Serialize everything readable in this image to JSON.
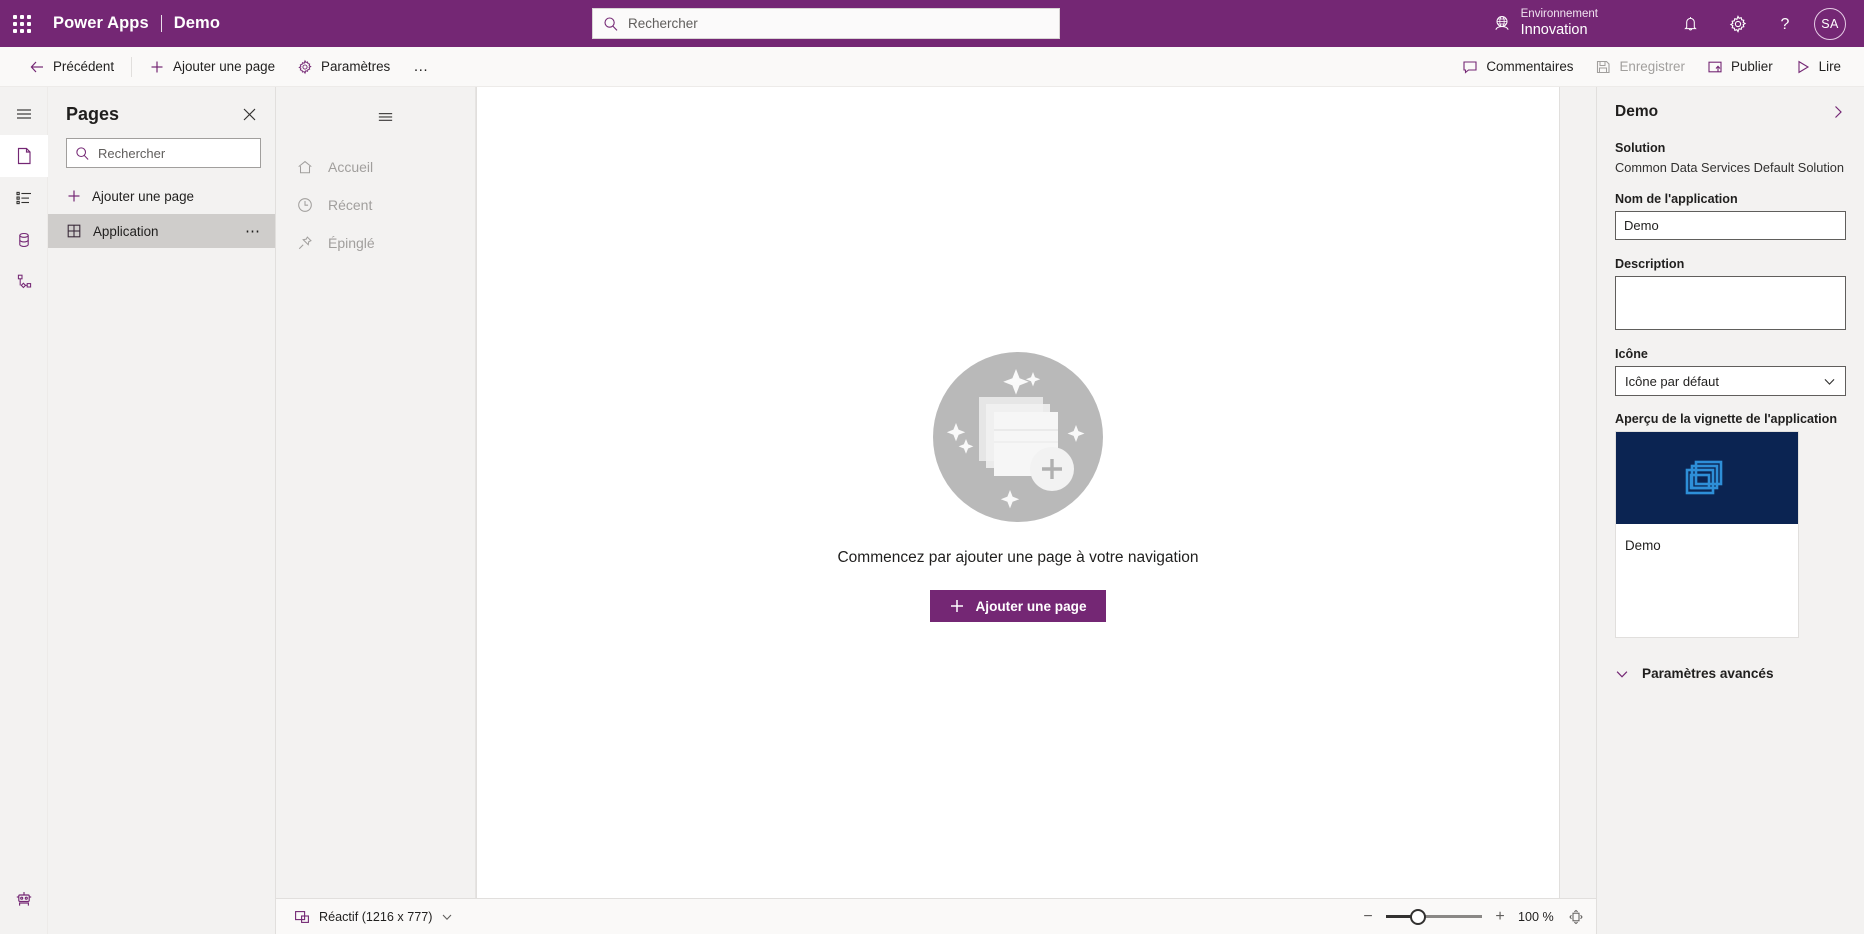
{
  "brand": {
    "waffle_icon": "app-launcher-icon",
    "product": "Power Apps",
    "separator": "|",
    "app_name": "Demo"
  },
  "search": {
    "placeholder": "Rechercher",
    "value": "",
    "icon": "search-icon"
  },
  "environment": {
    "icon": "globe-icon",
    "label": "Environnement",
    "name": "Innovation"
  },
  "header_actions": {
    "notifications_icon": "bell-icon",
    "settings_icon": "gear-icon",
    "help_icon": "question-mark-icon",
    "avatar_initials": "SA"
  },
  "commandbar": {
    "back": {
      "label": "Précédent",
      "icon": "arrow-left-icon"
    },
    "add_page": {
      "label": "Ajouter une page",
      "icon": "plus-icon"
    },
    "settings": {
      "label": "Paramètres",
      "icon": "gear-icon"
    },
    "overflow": {
      "label": "…",
      "icon": "ellipsis-icon"
    },
    "comments": {
      "label": "Commentaires",
      "icon": "comment-icon"
    },
    "save": {
      "label": "Enregistrer",
      "icon": "save-icon",
      "disabled": true
    },
    "publish": {
      "label": "Publier",
      "icon": "publish-icon"
    },
    "play": {
      "label": "Lire",
      "icon": "play-icon"
    }
  },
  "rail": {
    "items": [
      {
        "icon": "hamburger-menu-icon",
        "name": "menu",
        "selected": false
      },
      {
        "icon": "page-icon",
        "name": "pages",
        "selected": true
      },
      {
        "icon": "navigation-list-icon",
        "name": "navigation",
        "selected": false
      },
      {
        "icon": "data-cylinder-icon",
        "name": "data",
        "selected": false
      },
      {
        "icon": "automation-flow-icon",
        "name": "automation",
        "selected": false
      }
    ],
    "bottom": {
      "icon": "copilot-robot-icon",
      "name": "copilot"
    }
  },
  "pages_panel": {
    "title": "Pages",
    "close_icon": "close-icon",
    "search_placeholder": "Rechercher",
    "search_value": "",
    "search_icon": "search-icon",
    "add_page_label": "Ajouter une page",
    "add_page_icon": "plus-icon",
    "tree": [
      {
        "label": "Application",
        "icon": "app-grid-icon",
        "more_icon": "ellipsis-icon",
        "selected": true
      }
    ]
  },
  "app_preview_nav": {
    "burger_icon": "hamburger-menu-icon",
    "items": [
      {
        "label": "Accueil",
        "icon": "home-icon"
      },
      {
        "label": "Récent",
        "icon": "clock-icon"
      },
      {
        "label": "Épinglé",
        "icon": "pin-icon"
      }
    ]
  },
  "empty_state": {
    "illustration": "stacked-pages-add-illustration",
    "message": "Commencez par ajouter une page à votre navigation",
    "button_label": "Ajouter une page",
    "button_icon": "plus-icon"
  },
  "statusbar": {
    "screen_size_icon": "responsive-screen-icon",
    "screen_size_label": "Réactif (1216 x 777)",
    "chevron_icon": "chevron-down-icon",
    "zoom_out_icon": "minus-icon",
    "zoom_in_icon": "plus-icon",
    "zoom_value": "100 %",
    "fit_icon": "fit-to-screen-icon",
    "slider_percent": 25
  },
  "properties": {
    "title": "Demo",
    "collapse_icon": "chevron-right-icon",
    "solution_label": "Solution",
    "solution_value": "Common Data Services Default Solution",
    "app_name_label": "Nom de l'application",
    "app_name_value": "Demo",
    "description_label": "Description",
    "description_value": "",
    "icon_label": "Icône",
    "icon_value": "Icône par défaut",
    "icon_chevron": "chevron-down-icon",
    "tile_preview_label": "Aperçu de la vignette de l'application",
    "tile_icon": "app-window-stack-icon",
    "tile_name": "Demo",
    "advanced_label": "Paramètres avancés",
    "advanced_chevron": "chevron-down-icon"
  },
  "colors": {
    "brand_purple": "#742774",
    "tile_navy": "#0b2452",
    "tile_icon_blue": "#2e8fd8",
    "panel_gray": "#f3f2f1",
    "selected_gray": "#cfcdcb"
  }
}
